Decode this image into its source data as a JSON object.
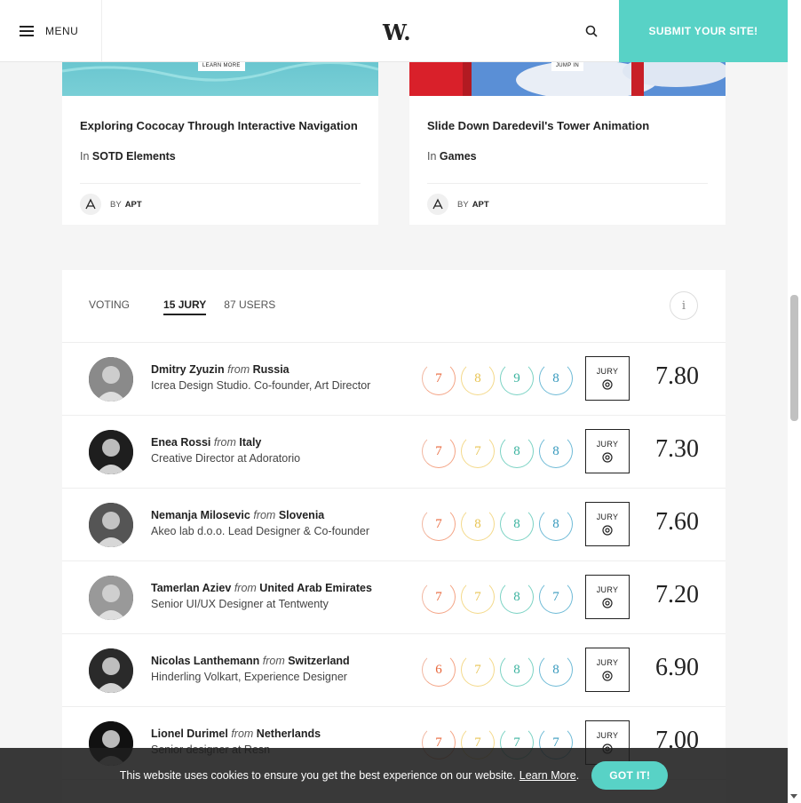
{
  "header": {
    "menu_label": "MENU",
    "logo": "W.",
    "submit_label": "SUBMIT YOUR SITE!"
  },
  "cards": [
    {
      "image_button": "LEARN MORE",
      "title": "Exploring Cococay Through Interactive Navigation",
      "category_prefix": "In",
      "category": "SOTD Elements",
      "by_prefix": "BY",
      "author": "APT"
    },
    {
      "image_button": "JUMP IN",
      "title": "Slide Down Daredevil's Tower Animation",
      "category_prefix": "In",
      "category": "Games",
      "by_prefix": "BY",
      "author": "APT"
    }
  ],
  "voting": {
    "tab_voting": "VOTING",
    "tab_jury": "15 JURY",
    "tab_users": "87 USERS",
    "info_label": "i",
    "jury_label": "JURY",
    "from": "from",
    "rows": [
      {
        "name": "Dmitry Zyuzin",
        "country": "Russia",
        "role": "Icrea Design Studio. Co-founder, Art Director",
        "scores": [
          "7",
          "8",
          "9",
          "8"
        ],
        "average": "7.80"
      },
      {
        "name": "Enea Rossi",
        "country": "Italy",
        "role": "Creative Director at Adoratorio",
        "scores": [
          "7",
          "7",
          "8",
          "8"
        ],
        "average": "7.30"
      },
      {
        "name": "Nemanja Milosevic",
        "country": "Slovenia",
        "role": "Akeo lab d.o.o. Lead Designer & Co-founder",
        "scores": [
          "7",
          "8",
          "8",
          "8"
        ],
        "average": "7.60"
      },
      {
        "name": "Tamerlan Aziev",
        "country": "United Arab Emirates",
        "role": "Senior UI/UX Designer at Tentwenty",
        "scores": [
          "7",
          "7",
          "8",
          "7"
        ],
        "average": "7.20"
      },
      {
        "name": "Nicolas Lanthemann",
        "country": "Switzerland",
        "role": "Hinderling Volkart, Experience Designer",
        "scores": [
          "6",
          "7",
          "8",
          "8"
        ],
        "average": "6.90"
      },
      {
        "name": "Lionel Durimel",
        "country": "Netherlands",
        "role": "Senior designer at Resn",
        "scores": [
          "7",
          "7",
          "7",
          "7"
        ],
        "average": "7.00"
      }
    ]
  },
  "cookie": {
    "text": "This website uses cookies to ensure you get the best experience on our website.",
    "link": "Learn More",
    "button": "GOT IT!"
  }
}
